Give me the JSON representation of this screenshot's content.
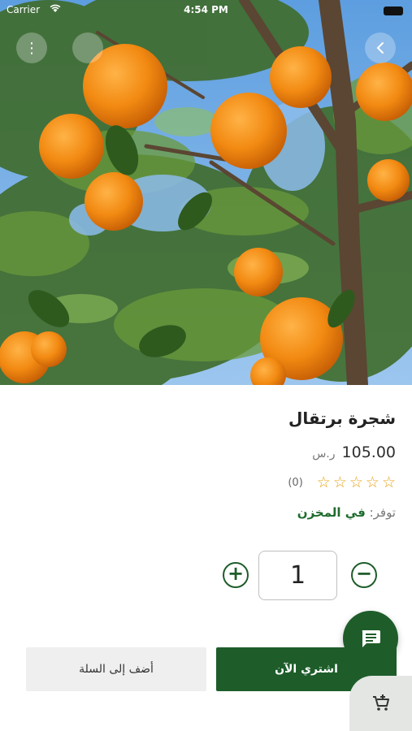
{
  "status_bar": {
    "carrier": "Carrier",
    "time": "4:54 PM"
  },
  "hero": {
    "image_subject": "orange tree with ripe oranges against blue sky"
  },
  "product": {
    "title": "شجرة برتقال",
    "price": "105.00",
    "currency": "ر.س",
    "rating_stars": 0,
    "rating_max": 5,
    "rating_count": "(0)",
    "stock_label": "توفر:",
    "stock_value": "في المخزن"
  },
  "quantity": {
    "value": "1",
    "plus_symbol": "+",
    "minus_symbol": "−"
  },
  "actions": {
    "buy_now": "اشتري الآن",
    "add_to_cart": "أضف إلى السلة"
  },
  "icons": {
    "chat": "chat-icon",
    "cart": "cart-add-icon",
    "share": "share-icon",
    "more": "more-icon",
    "back": "back-icon"
  },
  "colors": {
    "primary": "#1e5d2a",
    "star": "#e8a319",
    "secondary_button": "#efefef"
  }
}
